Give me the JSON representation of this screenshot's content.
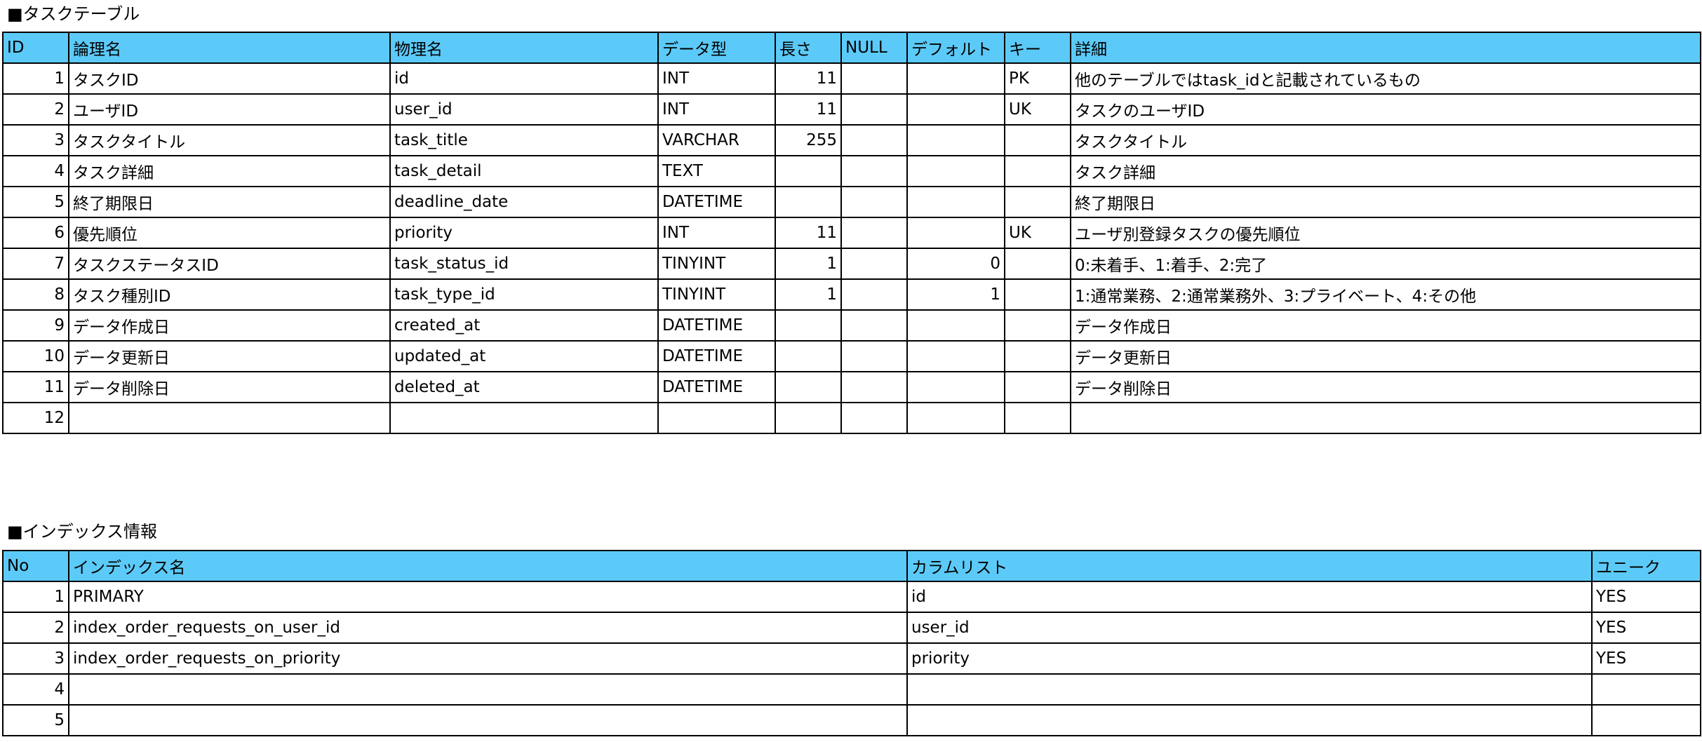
{
  "task_section": {
    "title": "■タスクテーブル",
    "headers": [
      "ID",
      "論理名",
      "物理名",
      "データ型",
      "長さ",
      "NULL",
      "デフォルト",
      "キー",
      "詳細"
    ],
    "rows": [
      [
        "1",
        "タスクID",
        "id",
        "INT",
        "11",
        "",
        "",
        "PK",
        "他のテーブルではtask_idと記載されているもの"
      ],
      [
        "2",
        "ユーザID",
        "user_id",
        "INT",
        "11",
        "",
        "",
        "UK",
        "タスクのユーザID"
      ],
      [
        "3",
        "タスクタイトル",
        "task_title",
        "VARCHAR",
        "255",
        "",
        "",
        "",
        "タスクタイトル"
      ],
      [
        "4",
        "タスク詳細",
        "task_detail",
        "TEXT",
        "",
        "",
        "",
        "",
        "タスク詳細"
      ],
      [
        "5",
        "終了期限日",
        "deadline_date",
        "DATETIME",
        "",
        "",
        "",
        "",
        "終了期限日"
      ],
      [
        "6",
        "優先順位",
        "priority",
        "INT",
        "11",
        "",
        "",
        "UK",
        "ユーザ別登録タスクの優先順位"
      ],
      [
        "7",
        "タスクステータスID",
        "task_status_id",
        "TINYINT",
        "1",
        "",
        "0",
        "",
        "0:未着手、1:着手、2:完了"
      ],
      [
        "8",
        "タスク種別ID",
        "task_type_id",
        "TINYINT",
        "1",
        "",
        "1",
        "",
        "1:通常業務、2:通常業務外、3:プライベート、4:その他"
      ],
      [
        "9",
        "データ作成日",
        "created_at",
        "DATETIME",
        "",
        "",
        "",
        "",
        "データ作成日"
      ],
      [
        "10",
        "データ更新日",
        "updated_at",
        "DATETIME",
        "",
        "",
        "",
        "",
        "データ更新日"
      ],
      [
        "11",
        "データ削除日",
        "deleted_at",
        "DATETIME",
        "",
        "",
        "",
        "",
        "データ削除日"
      ],
      [
        "12",
        "",
        "",
        "",
        "",
        "",
        "",
        "",
        ""
      ]
    ]
  },
  "index_section": {
    "title": "■インデックス情報",
    "headers": [
      "No",
      "インデックス名",
      "カラムリスト",
      "ユニーク"
    ],
    "rows": [
      [
        "1",
        "PRIMARY",
        "id",
        "YES"
      ],
      [
        "2",
        "index_order_requests_on_user_id",
        "user_id",
        "YES"
      ],
      [
        "3",
        "index_order_requests_on_priority",
        "priority",
        "YES"
      ],
      [
        "4",
        "",
        "",
        ""
      ],
      [
        "5",
        "",
        "",
        ""
      ]
    ]
  },
  "colors": {
    "header_background": "#5ccaf8",
    "border": "#000000"
  }
}
